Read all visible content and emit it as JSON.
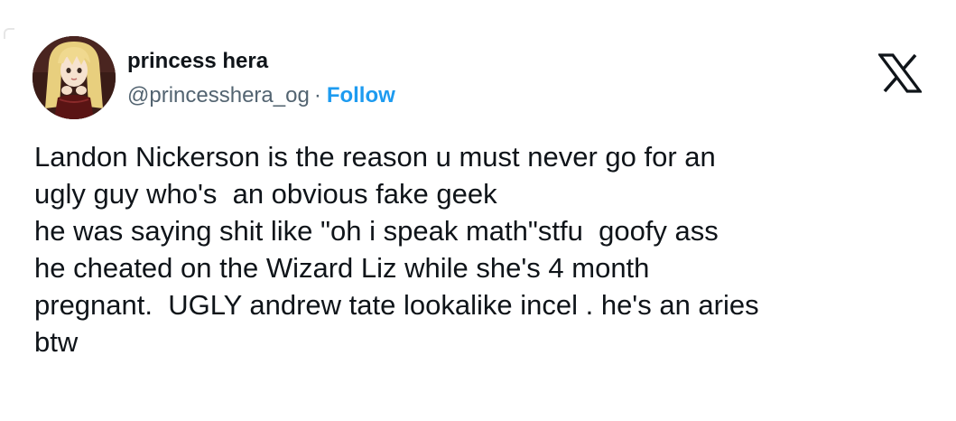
{
  "author": {
    "display_name": "princess hera",
    "handle": "@princesshera_og",
    "separator": "·",
    "follow_label": "Follow",
    "avatar": "anime-girl-avatar"
  },
  "brand_icon": "x-logo-icon",
  "tweet": {
    "lines": [
      "Landon Nickerson is the reason u must never go for an",
      "ugly guy who's  an obvious fake geek",
      "he was saying shit like \"oh i speak math\"stfu  goofy ass",
      "he cheated on the Wizard Liz while she's 4 month",
      "pregnant.  UGLY andrew tate lookalike incel . he's an aries",
      "btw"
    ]
  },
  "colors": {
    "text": "#0f1419",
    "secondary": "#536471",
    "link": "#1d9bf0",
    "background": "#ffffff"
  }
}
